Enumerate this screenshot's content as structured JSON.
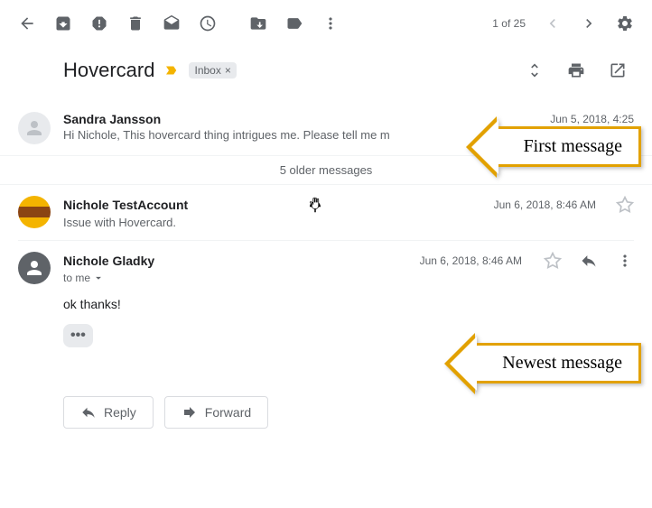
{
  "toolbar": {
    "page_count": "1 of 25"
  },
  "subject": {
    "text": "Hovercard",
    "label": "Inbox"
  },
  "messages": {
    "first": {
      "sender": "Sandra Jansson",
      "timestamp": "Jun 5, 2018, 4:25",
      "snippet": "Hi Nichole, This hovercard thing intrigues me. Please tell me m"
    },
    "older_link": "5 older messages",
    "second": {
      "sender": "Nichole TestAccount",
      "timestamp": "Jun 6, 2018, 8:46 AM",
      "snippet": "Issue with Hovercard."
    },
    "current": {
      "sender": "Nichole Gladky",
      "timestamp": "Jun 6, 2018, 8:46 AM",
      "to_line": "to me",
      "body": "ok thanks!"
    }
  },
  "buttons": {
    "reply": "Reply",
    "forward": "Forward"
  },
  "annotations": {
    "first": "First message",
    "newest": "Newest message"
  }
}
